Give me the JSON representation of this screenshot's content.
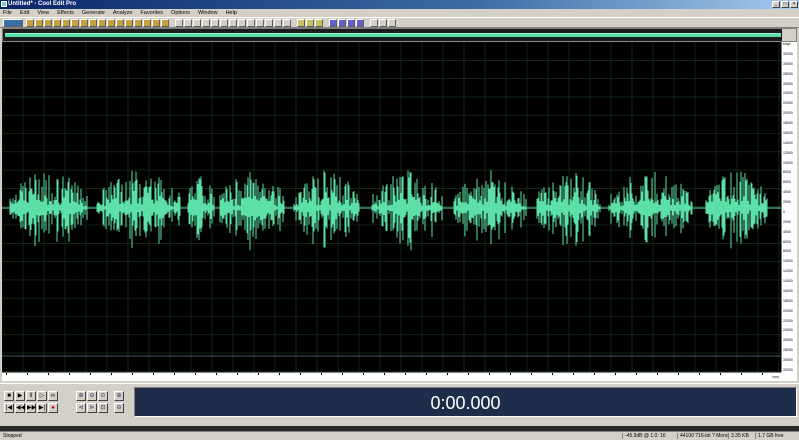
{
  "window": {
    "title": "Untitled* - Cool Edit Pro"
  },
  "menu": [
    "File",
    "Edit",
    "View",
    "Effects",
    "Generate",
    "Analyze",
    "Favorites",
    "Options",
    "Window",
    "Help"
  ],
  "time_display": "0:00.000",
  "y_ruler_ticks": [
    "smpl",
    "32000",
    "30000",
    "28000",
    "26000",
    "24000",
    "22000",
    "20000",
    "18000",
    "16000",
    "14000",
    "12000",
    "10000",
    "8000",
    "6000",
    "4000",
    "2000",
    "0",
    "2000",
    "4000",
    "6000",
    "8000",
    "10000",
    "12000",
    "14000",
    "16000",
    "18000",
    "20000",
    "22000",
    "24000",
    "26000",
    "28000",
    "30000",
    "32000"
  ],
  "x_ruler_unit": "hms",
  "status": {
    "state": "Stopped",
    "level": "-45.9dB @ 1.0: 16",
    "format": "44100 ?16-bit ? Mono",
    "size": "3.35 KB",
    "free": "1.7 GB free"
  },
  "colors": {
    "waveform": "#5ce0a8",
    "background": "#000000",
    "grid": "#1e3a1e",
    "time_bg": "#1e2e4a"
  }
}
